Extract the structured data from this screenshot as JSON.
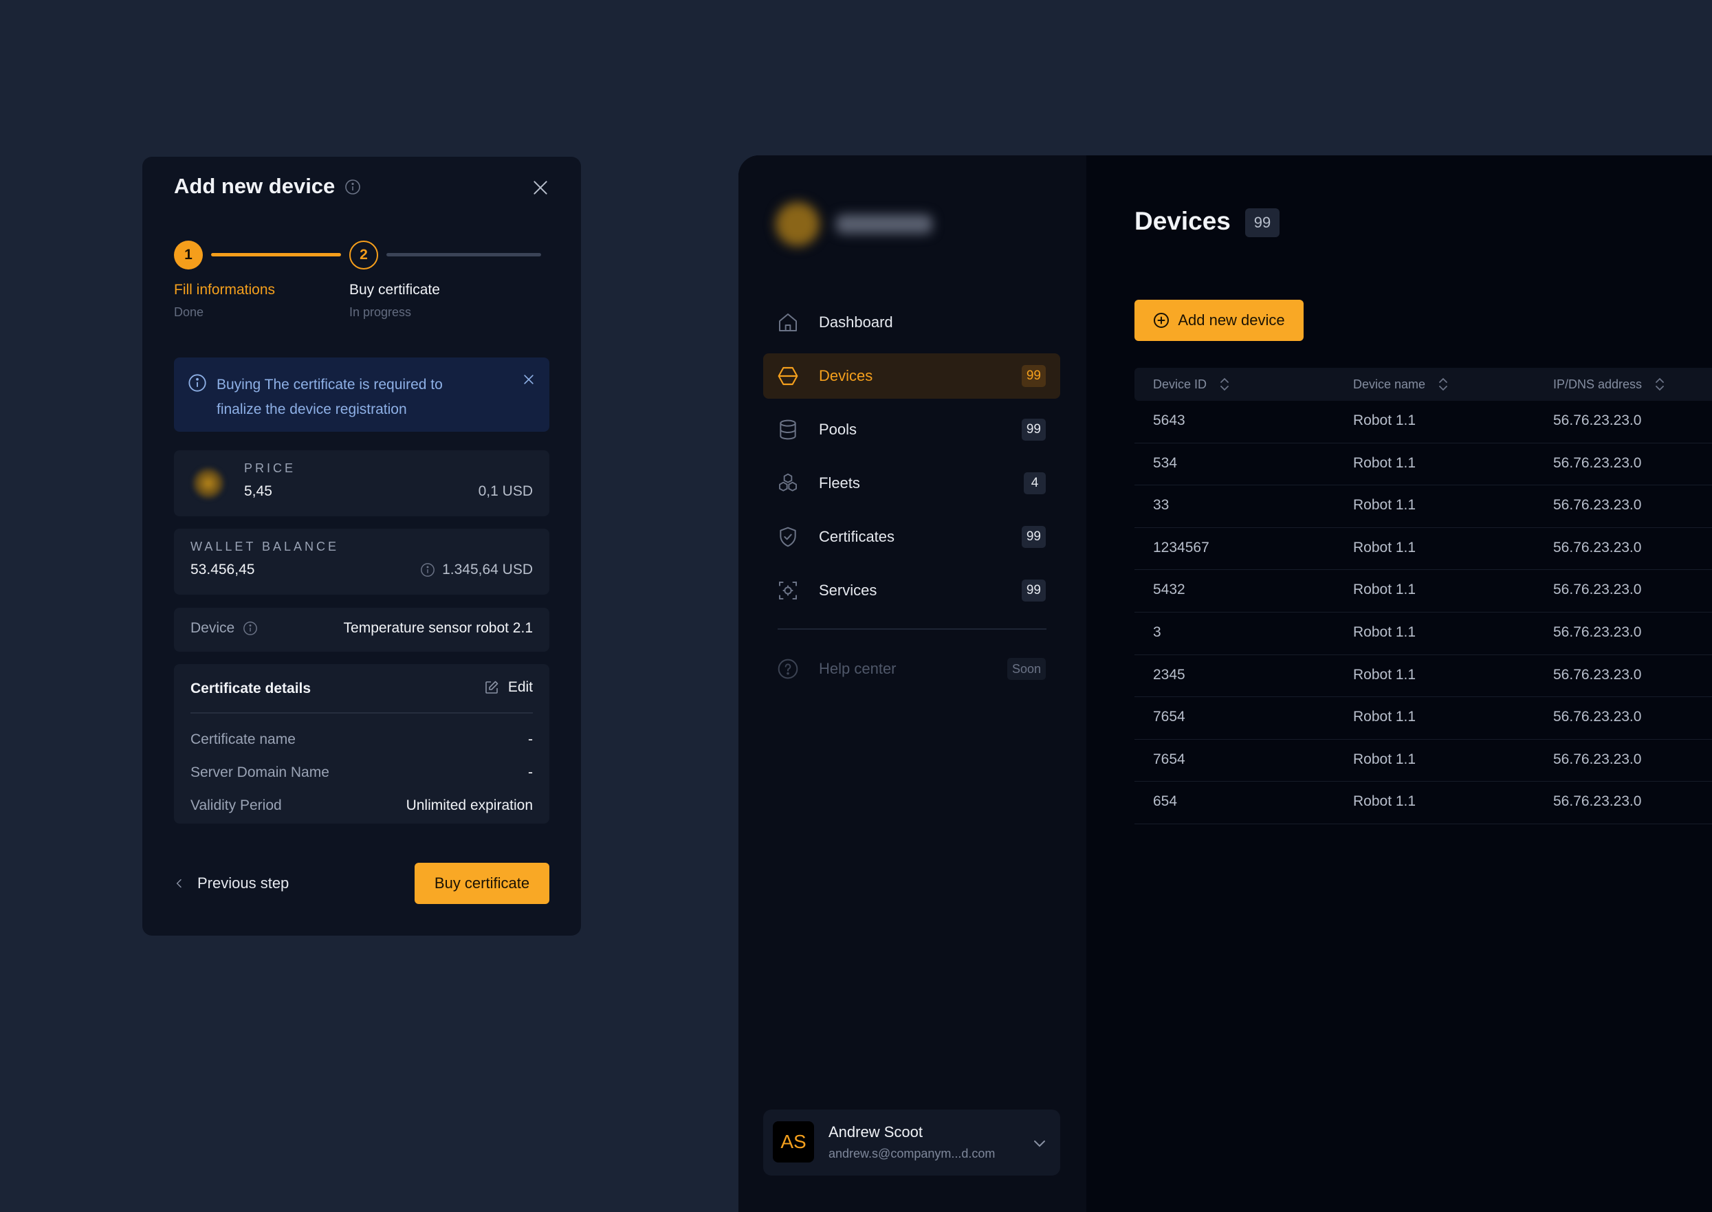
{
  "modal": {
    "title": "Add new device",
    "steps": [
      {
        "number": "1",
        "label": "Fill informations",
        "status": "Done"
      },
      {
        "number": "2",
        "label": "Buy certificate",
        "status": "In progress"
      }
    ],
    "alert": {
      "line1": "Buying The certificate is required to",
      "line2": "finalize the device registration"
    },
    "price": {
      "label": "PRICE",
      "value": "5,45",
      "usd": "0,1 USD"
    },
    "wallet": {
      "label": "WALLET BALANCE",
      "value": "53.456,45",
      "usd": "1.345,64 USD"
    },
    "device": {
      "label": "Device",
      "value": "Temperature sensor robot 2.1"
    },
    "certificate": {
      "title": "Certificate details",
      "edit_label": "Edit",
      "rows": [
        {
          "label": "Certificate name",
          "value": "-"
        },
        {
          "label": "Server Domain Name",
          "value": "-"
        },
        {
          "label": "Validity Period",
          "value": "Unlimited expiration"
        }
      ]
    },
    "previous_label": "Previous step",
    "buy_label": "Buy certificate"
  },
  "sidebar": {
    "items": [
      {
        "label": "Dashboard",
        "icon": "home-icon",
        "badge": ""
      },
      {
        "label": "Devices",
        "icon": "hexagon-icon",
        "badge": "99",
        "active": true
      },
      {
        "label": "Pools",
        "icon": "database-icon",
        "badge": "99"
      },
      {
        "label": "Fleets",
        "icon": "boxes-icon",
        "badge": "4"
      },
      {
        "label": "Certificates",
        "icon": "shield-icon",
        "badge": "99"
      },
      {
        "label": "Services",
        "icon": "services-icon",
        "badge": "99"
      }
    ],
    "help": {
      "label": "Help center",
      "badge": "Soon"
    },
    "user": {
      "initials": "AS",
      "name": "Andrew Scoot",
      "email": "andrew.s@companym...d.com"
    }
  },
  "main": {
    "title": "Devices",
    "count": "99",
    "add_label": "Add new device",
    "columns": [
      "Device ID",
      "Device name",
      "IP/DNS address"
    ],
    "rows": [
      [
        "5643",
        "Robot 1.1",
        "56.76.23.23.0"
      ],
      [
        "534",
        "Robot 1.1",
        "56.76.23.23.0"
      ],
      [
        "33",
        "Robot 1.1",
        "56.76.23.23.0"
      ],
      [
        "1234567",
        "Robot 1.1",
        "56.76.23.23.0"
      ],
      [
        "5432",
        "Robot 1.1",
        "56.76.23.23.0"
      ],
      [
        "3",
        "Robot 1.1",
        "56.76.23.23.0"
      ],
      [
        "2345",
        "Robot 1.1",
        "56.76.23.23.0"
      ],
      [
        "7654",
        "Robot 1.1",
        "56.76.23.23.0"
      ],
      [
        "7654",
        "Robot 1.1",
        "56.76.23.23.0"
      ],
      [
        "654",
        "Robot 1.1",
        "56.76.23.23.0"
      ]
    ]
  },
  "colors": {
    "accent": "#f9a825",
    "background": "#1b2436",
    "panel": "#0d1321"
  }
}
